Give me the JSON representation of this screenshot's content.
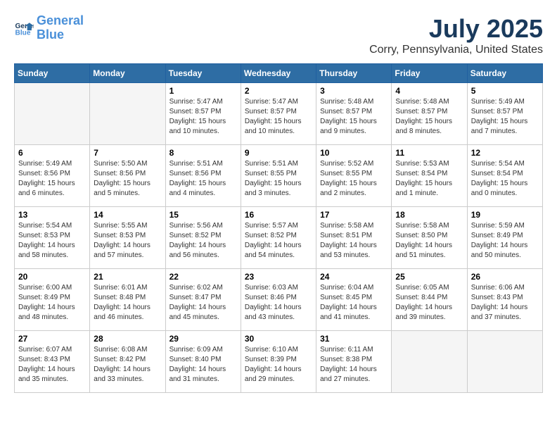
{
  "header": {
    "logo_line1": "General",
    "logo_line2": "Blue",
    "main_title": "July 2025",
    "subtitle": "Corry, Pennsylvania, United States"
  },
  "weekdays": [
    "Sunday",
    "Monday",
    "Tuesday",
    "Wednesday",
    "Thursday",
    "Friday",
    "Saturday"
  ],
  "weeks": [
    [
      {
        "day": "",
        "empty": true
      },
      {
        "day": "",
        "empty": true
      },
      {
        "day": "1",
        "sunrise": "Sunrise: 5:47 AM",
        "sunset": "Sunset: 8:57 PM",
        "daylight": "Daylight: 15 hours and 10 minutes."
      },
      {
        "day": "2",
        "sunrise": "Sunrise: 5:47 AM",
        "sunset": "Sunset: 8:57 PM",
        "daylight": "Daylight: 15 hours and 10 minutes."
      },
      {
        "day": "3",
        "sunrise": "Sunrise: 5:48 AM",
        "sunset": "Sunset: 8:57 PM",
        "daylight": "Daylight: 15 hours and 9 minutes."
      },
      {
        "day": "4",
        "sunrise": "Sunrise: 5:48 AM",
        "sunset": "Sunset: 8:57 PM",
        "daylight": "Daylight: 15 hours and 8 minutes."
      },
      {
        "day": "5",
        "sunrise": "Sunrise: 5:49 AM",
        "sunset": "Sunset: 8:57 PM",
        "daylight": "Daylight: 15 hours and 7 minutes."
      }
    ],
    [
      {
        "day": "6",
        "sunrise": "Sunrise: 5:49 AM",
        "sunset": "Sunset: 8:56 PM",
        "daylight": "Daylight: 15 hours and 6 minutes."
      },
      {
        "day": "7",
        "sunrise": "Sunrise: 5:50 AM",
        "sunset": "Sunset: 8:56 PM",
        "daylight": "Daylight: 15 hours and 5 minutes."
      },
      {
        "day": "8",
        "sunrise": "Sunrise: 5:51 AM",
        "sunset": "Sunset: 8:56 PM",
        "daylight": "Daylight: 15 hours and 4 minutes."
      },
      {
        "day": "9",
        "sunrise": "Sunrise: 5:51 AM",
        "sunset": "Sunset: 8:55 PM",
        "daylight": "Daylight: 15 hours and 3 minutes."
      },
      {
        "day": "10",
        "sunrise": "Sunrise: 5:52 AM",
        "sunset": "Sunset: 8:55 PM",
        "daylight": "Daylight: 15 hours and 2 minutes."
      },
      {
        "day": "11",
        "sunrise": "Sunrise: 5:53 AM",
        "sunset": "Sunset: 8:54 PM",
        "daylight": "Daylight: 15 hours and 1 minute."
      },
      {
        "day": "12",
        "sunrise": "Sunrise: 5:54 AM",
        "sunset": "Sunset: 8:54 PM",
        "daylight": "Daylight: 15 hours and 0 minutes."
      }
    ],
    [
      {
        "day": "13",
        "sunrise": "Sunrise: 5:54 AM",
        "sunset": "Sunset: 8:53 PM",
        "daylight": "Daylight: 14 hours and 58 minutes."
      },
      {
        "day": "14",
        "sunrise": "Sunrise: 5:55 AM",
        "sunset": "Sunset: 8:53 PM",
        "daylight": "Daylight: 14 hours and 57 minutes."
      },
      {
        "day": "15",
        "sunrise": "Sunrise: 5:56 AM",
        "sunset": "Sunset: 8:52 PM",
        "daylight": "Daylight: 14 hours and 56 minutes."
      },
      {
        "day": "16",
        "sunrise": "Sunrise: 5:57 AM",
        "sunset": "Sunset: 8:52 PM",
        "daylight": "Daylight: 14 hours and 54 minutes."
      },
      {
        "day": "17",
        "sunrise": "Sunrise: 5:58 AM",
        "sunset": "Sunset: 8:51 PM",
        "daylight": "Daylight: 14 hours and 53 minutes."
      },
      {
        "day": "18",
        "sunrise": "Sunrise: 5:58 AM",
        "sunset": "Sunset: 8:50 PM",
        "daylight": "Daylight: 14 hours and 51 minutes."
      },
      {
        "day": "19",
        "sunrise": "Sunrise: 5:59 AM",
        "sunset": "Sunset: 8:49 PM",
        "daylight": "Daylight: 14 hours and 50 minutes."
      }
    ],
    [
      {
        "day": "20",
        "sunrise": "Sunrise: 6:00 AM",
        "sunset": "Sunset: 8:49 PM",
        "daylight": "Daylight: 14 hours and 48 minutes."
      },
      {
        "day": "21",
        "sunrise": "Sunrise: 6:01 AM",
        "sunset": "Sunset: 8:48 PM",
        "daylight": "Daylight: 14 hours and 46 minutes."
      },
      {
        "day": "22",
        "sunrise": "Sunrise: 6:02 AM",
        "sunset": "Sunset: 8:47 PM",
        "daylight": "Daylight: 14 hours and 45 minutes."
      },
      {
        "day": "23",
        "sunrise": "Sunrise: 6:03 AM",
        "sunset": "Sunset: 8:46 PM",
        "daylight": "Daylight: 14 hours and 43 minutes."
      },
      {
        "day": "24",
        "sunrise": "Sunrise: 6:04 AM",
        "sunset": "Sunset: 8:45 PM",
        "daylight": "Daylight: 14 hours and 41 minutes."
      },
      {
        "day": "25",
        "sunrise": "Sunrise: 6:05 AM",
        "sunset": "Sunset: 8:44 PM",
        "daylight": "Daylight: 14 hours and 39 minutes."
      },
      {
        "day": "26",
        "sunrise": "Sunrise: 6:06 AM",
        "sunset": "Sunset: 8:43 PM",
        "daylight": "Daylight: 14 hours and 37 minutes."
      }
    ],
    [
      {
        "day": "27",
        "sunrise": "Sunrise: 6:07 AM",
        "sunset": "Sunset: 8:43 PM",
        "daylight": "Daylight: 14 hours and 35 minutes."
      },
      {
        "day": "28",
        "sunrise": "Sunrise: 6:08 AM",
        "sunset": "Sunset: 8:42 PM",
        "daylight": "Daylight: 14 hours and 33 minutes."
      },
      {
        "day": "29",
        "sunrise": "Sunrise: 6:09 AM",
        "sunset": "Sunset: 8:40 PM",
        "daylight": "Daylight: 14 hours and 31 minutes."
      },
      {
        "day": "30",
        "sunrise": "Sunrise: 6:10 AM",
        "sunset": "Sunset: 8:39 PM",
        "daylight": "Daylight: 14 hours and 29 minutes."
      },
      {
        "day": "31",
        "sunrise": "Sunrise: 6:11 AM",
        "sunset": "Sunset: 8:38 PM",
        "daylight": "Daylight: 14 hours and 27 minutes."
      },
      {
        "day": "",
        "empty": true
      },
      {
        "day": "",
        "empty": true
      }
    ]
  ]
}
